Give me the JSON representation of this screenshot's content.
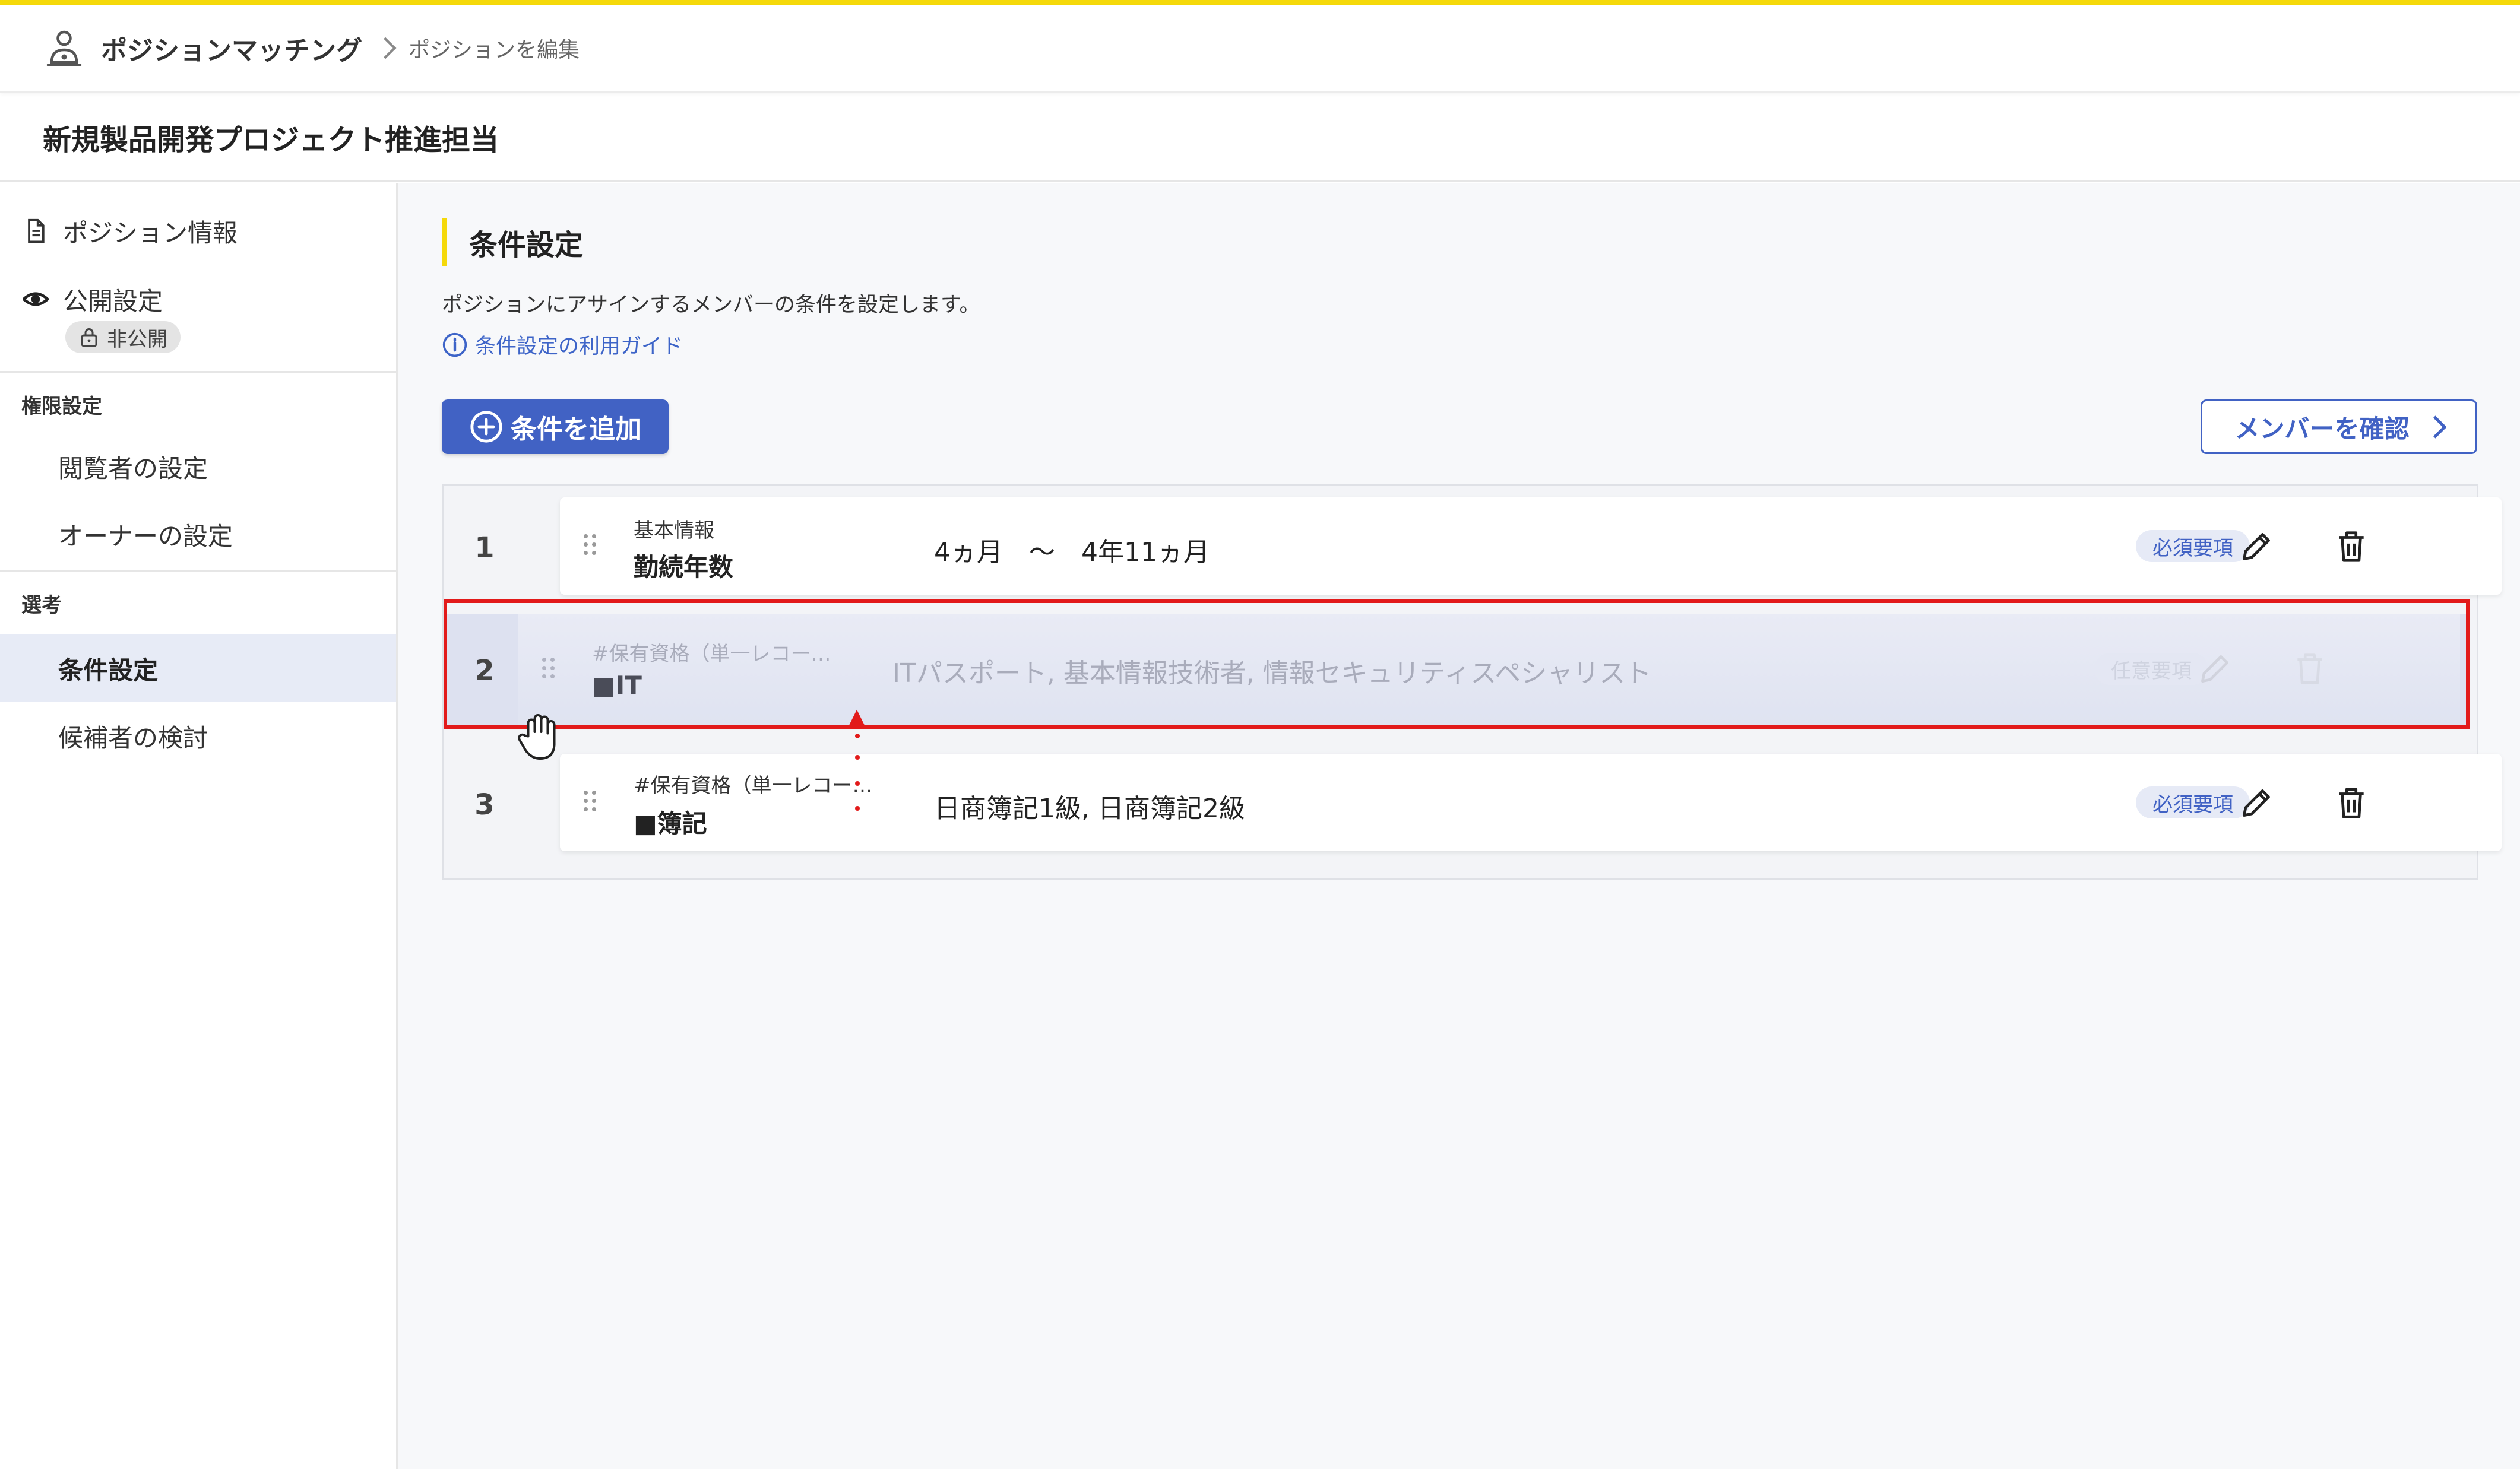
{
  "header": {
    "app_name": "ポジションマッチング",
    "breadcrumb_current": "ポジションを編集"
  },
  "page": {
    "title": "新規製品開発プロジェクト推進担当"
  },
  "sidebar": {
    "position_info": "ポジション情報",
    "publish_settings": "公開設定",
    "private_badge": "非公開",
    "permission_section": "権限設定",
    "viewer_settings": "閲覧者の設定",
    "owner_settings": "オーナーの設定",
    "selection_section": "選考",
    "condition_settings": "条件設定",
    "candidate_review": "候補者の検討"
  },
  "main": {
    "section_title": "条件設定",
    "description": "ポジションにアサインするメンバーの条件を設定します。",
    "guide_link": "条件設定の利用ガイド",
    "add_button": "条件を追加",
    "member_button": "メンバーを確認"
  },
  "conditions": [
    {
      "number": "1",
      "category": "基本情報",
      "name": "勤続年数",
      "value": "4ヵ月　～　4年11ヵ月",
      "requirement": "必須要項"
    },
    {
      "number": "2",
      "category": "#保有資格（単一レコー…",
      "name": "■IT",
      "value": "ITパスポート, 基本情報技術者, 情報セキュリティスペシャリスト",
      "requirement": "任意要項"
    },
    {
      "number": "3",
      "category": "#保有資格（単一レコー…",
      "name": "■簿記",
      "value": "日商簿記1級, 日商簿記2級",
      "requirement": "必須要項"
    }
  ],
  "colors": {
    "accent": "#4162c4",
    "brand_yellow": "#f5d90a",
    "drag_highlight": "#e21a1a"
  }
}
